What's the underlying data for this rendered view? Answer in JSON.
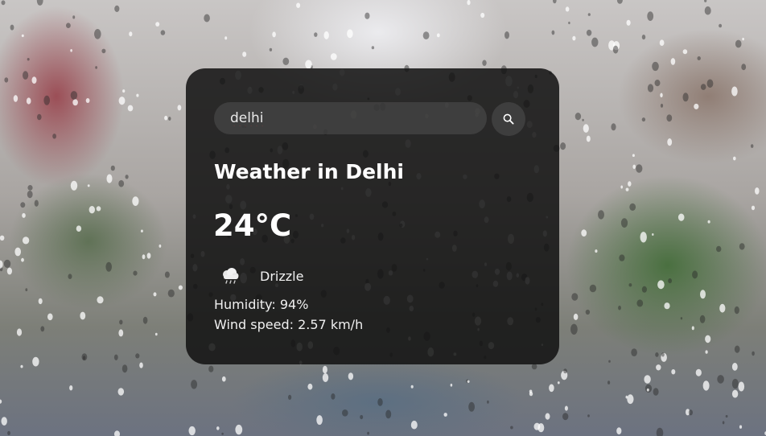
{
  "background": {
    "description_icon": "rainy-window-background"
  },
  "search": {
    "value": "delhi",
    "button_icon": "search-icon"
  },
  "weather": {
    "title": "Weather in Delhi",
    "temperature": "24°C",
    "condition_icon": "cloud-drizzle-icon",
    "condition": "Drizzle",
    "humidity": "Humidity: 94%",
    "wind": "Wind speed: 2.57 km/h"
  },
  "colors": {
    "card_background": "#121212",
    "text": "#ffffff",
    "input_background": "#505050"
  }
}
